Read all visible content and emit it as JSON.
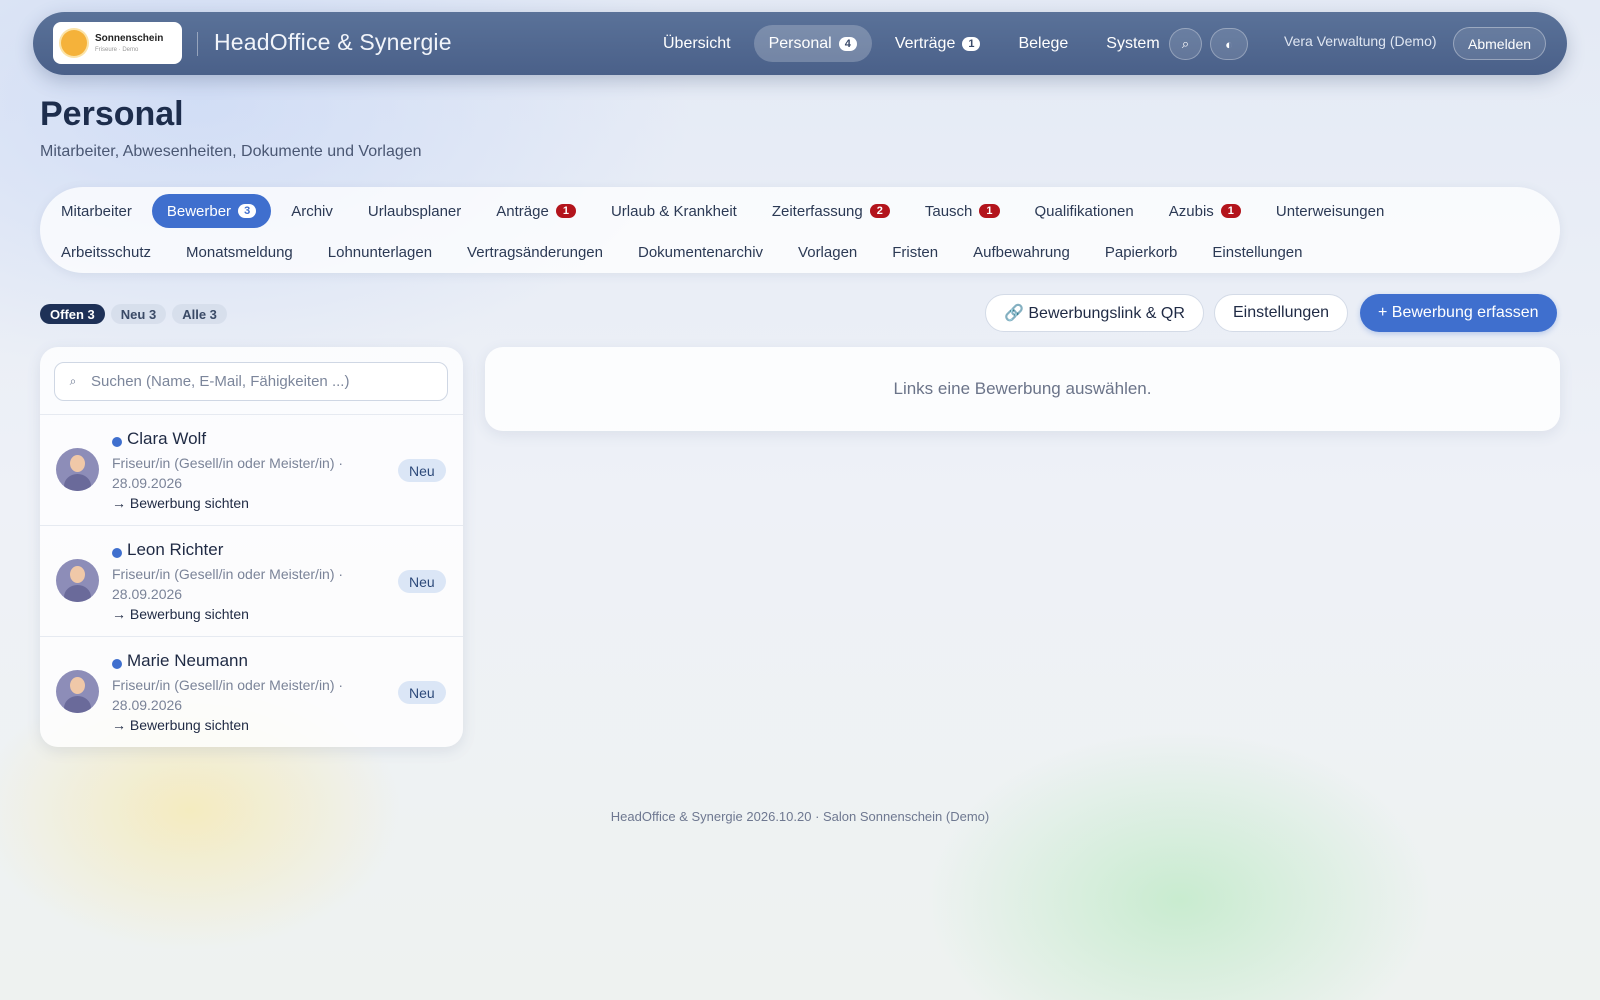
{
  "brand": {
    "logo_name": "Sonnenschein",
    "logo_tagline": "Friseure · Demo",
    "app_title": "HeadOffice & Synergie"
  },
  "nav": {
    "items": [
      {
        "label": "Übersicht"
      },
      {
        "label": "Personal",
        "badge": "4",
        "active": true
      },
      {
        "label": "Verträge",
        "badge": "1"
      },
      {
        "label": "Belege"
      },
      {
        "label": "System"
      }
    ],
    "search_icon": "⌕",
    "theme_icon": "◐",
    "user": "Vera Verwaltung (Demo)",
    "logout": "Abmelden"
  },
  "page": {
    "title": "Personal",
    "subtitle": "Mitarbeiter, Abwesenheiten, Dokumente und Vorlagen"
  },
  "tabs": {
    "row1": [
      {
        "label": "Mitarbeiter"
      },
      {
        "label": "Bewerber",
        "count": "3",
        "active": true
      },
      {
        "label": "Archiv"
      },
      {
        "label": "Urlaubsplaner"
      },
      {
        "label": "Anträge",
        "alert": "1"
      },
      {
        "label": "Urlaub & Krankheit"
      },
      {
        "label": "Zeiterfassung",
        "alert": "2"
      },
      {
        "label": "Tausch",
        "alert": "1"
      },
      {
        "label": "Qualifikationen"
      },
      {
        "label": "Azubis",
        "alert": "1"
      },
      {
        "label": "Unterweisungen"
      }
    ],
    "row2": [
      {
        "label": "Arbeitsschutz"
      },
      {
        "label": "Monatsmeldung"
      },
      {
        "label": "Lohnunterlagen"
      },
      {
        "label": "Vertragsänderungen"
      },
      {
        "label": "Dokumentenarchiv"
      },
      {
        "label": "Vorlagen"
      },
      {
        "label": "Fristen"
      },
      {
        "label": "Aufbewahrung"
      },
      {
        "label": "Papierkorb"
      },
      {
        "label": "Einstellungen"
      }
    ]
  },
  "filters": [
    {
      "label": "Offen 3",
      "active": true
    },
    {
      "label": "Neu 3"
    },
    {
      "label": "Alle 3"
    }
  ],
  "actions": {
    "link_qr": "🔗 Bewerbungslink & QR",
    "settings": "Einstellungen",
    "add": "+ Bewerbung erfassen"
  },
  "search": {
    "icon": "⌕",
    "placeholder": "Suchen (Name, E-Mail, Fähigkeiten ...)",
    "value": ""
  },
  "applicants": [
    {
      "name": "Clara Wolf",
      "meta": "Friseur/in (Gesell/in oder Meister/in) · 28.09.2026",
      "action": "→ Bewerbung sichten",
      "status": "Neu"
    },
    {
      "name": "Leon Richter",
      "meta": "Friseur/in (Gesell/in oder Meister/in) · 28.09.2026",
      "action": "→ Bewerbung sichten",
      "status": "Neu"
    },
    {
      "name": "Marie Neumann",
      "meta": "Friseur/in (Gesell/in oder Meister/in) · 28.09.2026",
      "action": "→ Bewerbung sichten",
      "status": "Neu"
    }
  ],
  "detail": {
    "empty_text": "Links eine Bewerbung auswählen."
  },
  "footer": {
    "text": "HeadOffice & Synergie 2026.10.20 · Salon Sonnenschein (Demo)"
  },
  "colors": {
    "accent": "#3f6fce",
    "nav_bg": "#4f668f",
    "alert_badge": "#b3141c",
    "filter_active": "#1e3157"
  }
}
